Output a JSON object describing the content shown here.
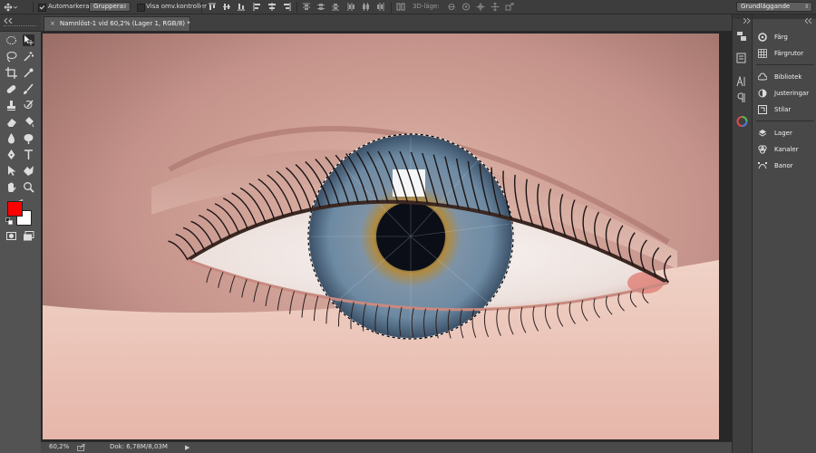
{
  "options_bar": {
    "auto_select_label": "Automarkera:",
    "auto_select_checked": true,
    "auto_select_target": "Gruppera",
    "show_transform_label": "Visa omv.kontroller",
    "show_transform_checked": false,
    "mode_3d_label": "3D-läge:",
    "workspace": "Grundläggande"
  },
  "document": {
    "tab_title": "Namnlöst-1 vid 60,2% (Lager 1, RGB/8) *",
    "close_glyph": "×",
    "zoom": "60,2%",
    "doc_info": "Dok: 6,78M/8,03M"
  },
  "colors": {
    "foreground": "#ff0000",
    "background": "#ffffff"
  },
  "panels": [
    {
      "label": "Färg",
      "icon": "color-wheel-icon"
    },
    {
      "label": "Färgrutor",
      "icon": "swatches-grid-icon"
    },
    {
      "label": "Bibliotek",
      "icon": "library-cloud-icon"
    },
    {
      "label": "Justeringar",
      "icon": "adjustments-circle-icon"
    },
    {
      "label": "Stilar",
      "icon": "styles-fx-icon"
    },
    {
      "label": "Lager",
      "icon": "layers-stack-icon"
    },
    {
      "label": "Kanaler",
      "icon": "channels-circles-icon"
    },
    {
      "label": "Banor",
      "icon": "paths-bezier-icon"
    }
  ]
}
